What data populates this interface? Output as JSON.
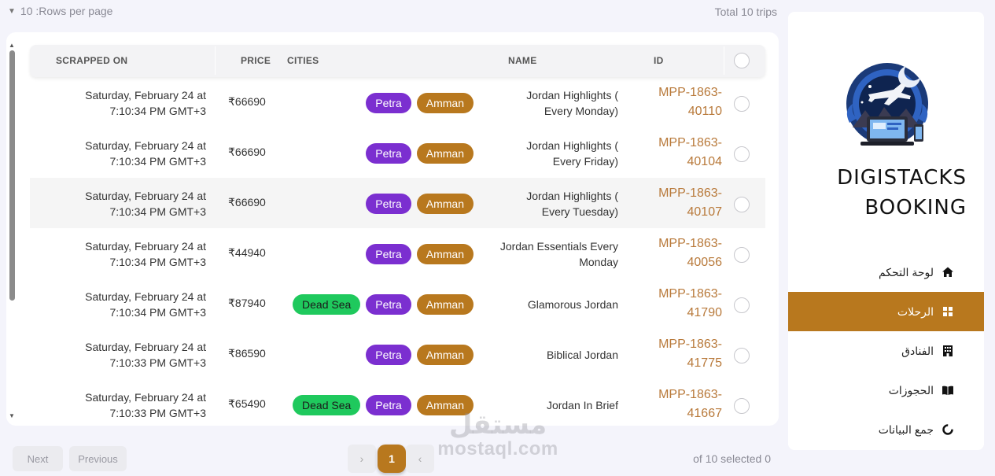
{
  "top": {
    "rows_per_page": "10 :Rows per page",
    "total_trips": "Total 10 trips"
  },
  "table": {
    "headers": {
      "scrapped_on": "SCRAPPED ON",
      "price": "PRICE",
      "cities": "CITIES",
      "name": "NAME",
      "id": "ID"
    },
    "rows": [
      {
        "date1": "Saturday, February 24 at",
        "date2": "7:10:34 PM GMT+3",
        "price": "₹66690",
        "cities": [
          "Amman",
          "Petra"
        ],
        "name1": "Jordan Highlights (",
        "name2": "Every Monday)",
        "id1": "MPP-1863-",
        "id2": "40110"
      },
      {
        "date1": "Saturday, February 24 at",
        "date2": "7:10:34 PM GMT+3",
        "price": "₹66690",
        "cities": [
          "Amman",
          "Petra"
        ],
        "name1": "Jordan Highlights (",
        "name2": "Every Friday)",
        "id1": "MPP-1863-",
        "id2": "40104"
      },
      {
        "date1": "Saturday, February 24 at",
        "date2": "7:10:34 PM GMT+3",
        "price": "₹66690",
        "cities": [
          "Amman",
          "Petra"
        ],
        "name1": "Jordan Highlights (",
        "name2": "Every Tuesday)",
        "id1": "MPP-1863-",
        "id2": "40107"
      },
      {
        "date1": "Saturday, February 24 at",
        "date2": "7:10:34 PM GMT+3",
        "price": "₹44940",
        "cities": [
          "Amman",
          "Petra"
        ],
        "name1": "Jordan Essentials Every",
        "name2": "Monday",
        "id1": "MPP-1863-",
        "id2": "40056"
      },
      {
        "date1": "Saturday, February 24 at",
        "date2": "7:10:34 PM GMT+3",
        "price": "₹87940",
        "cities": [
          "Amman",
          "Petra",
          "Dead Sea"
        ],
        "name1": "Glamorous Jordan",
        "name2": "",
        "id1": "MPP-1863-",
        "id2": "41790"
      },
      {
        "date1": "Saturday, February 24 at",
        "date2": "7:10:33 PM GMT+3",
        "price": "₹86590",
        "cities": [
          "Amman",
          "Petra"
        ],
        "name1": "Biblical Jordan",
        "name2": "",
        "id1": "MPP-1863-",
        "id2": "41775"
      },
      {
        "date1": "Saturday, February 24 at",
        "date2": "7:10:33 PM GMT+3",
        "price": "₹65490",
        "cities": [
          "Amman",
          "Petra",
          "Dead Sea"
        ],
        "name1": "Jordan In Brief",
        "name2": "",
        "id1": "MPP-1863-",
        "id2": "41667"
      }
    ]
  },
  "pagination": {
    "next": "Next",
    "previous": "Previous",
    "current_page": "1",
    "left_arrow": "›",
    "right_arrow": "‹",
    "selected": "of 10 selected 0"
  },
  "watermark": {
    "arabic": "مستقل",
    "english": "mostaql.com"
  },
  "sidebar": {
    "brand_line1": "DIGISTACKS",
    "brand_line2": "BOOKING",
    "nav": [
      {
        "label": "لوحة التحكم",
        "icon": "home-icon",
        "active": false
      },
      {
        "label": "الرحلات",
        "icon": "grid-icon",
        "active": true
      },
      {
        "label": "الفنادق",
        "icon": "building-icon",
        "active": false
      },
      {
        "label": "الحجوزات",
        "icon": "book-icon",
        "active": false
      },
      {
        "label": "جمع البيانات",
        "icon": "spinner-icon",
        "active": false
      }
    ]
  },
  "colors": {
    "accent": "#b8781e",
    "petra": "#7b2fd0",
    "dead_sea": "#1fc95d",
    "id_text": "#b8793a"
  }
}
